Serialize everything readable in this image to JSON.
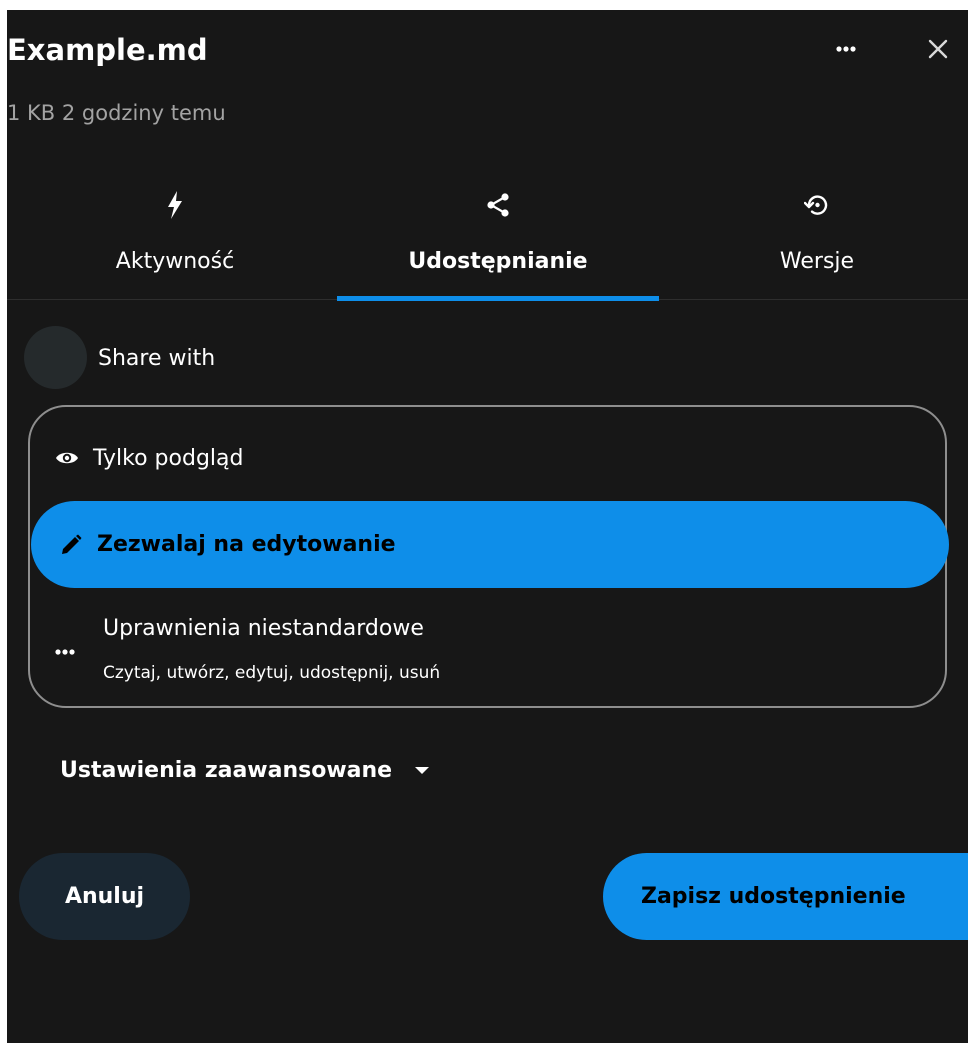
{
  "header": {
    "title": "Example.md",
    "subtitle": "1 KB 2 godziny temu",
    "menu_icon": "more-horizontal-icon",
    "close_icon": "close-icon"
  },
  "tabs": [
    {
      "label": "Aktywność",
      "icon": "lightning-icon",
      "active": false
    },
    {
      "label": "Udostępnianie",
      "icon": "share-icon",
      "active": true
    },
    {
      "label": "Wersje",
      "icon": "history-icon",
      "active": false
    }
  ],
  "share": {
    "label": "Share with"
  },
  "permissions": {
    "view": {
      "label": "Tylko podgląd",
      "icon": "eye-icon"
    },
    "edit": {
      "label": "Zezwalaj na edytowanie",
      "icon": "pencil-icon",
      "selected": true
    },
    "custom": {
      "label": "Uprawnienia niestandardowe",
      "description": "Czytaj, utwórz, edytuj, udostępnij, usuń",
      "icon": "more-horizontal-icon"
    }
  },
  "advanced": {
    "label": "Ustawienia zaawansowane",
    "icon": "caret-down-icon"
  },
  "actions": {
    "cancel_label": "Anuluj",
    "save_label": "Zapisz udostępnienie"
  },
  "colors": {
    "accent": "#0e8ee9",
    "background": "#171717",
    "cancel_background": "#1a2732"
  }
}
